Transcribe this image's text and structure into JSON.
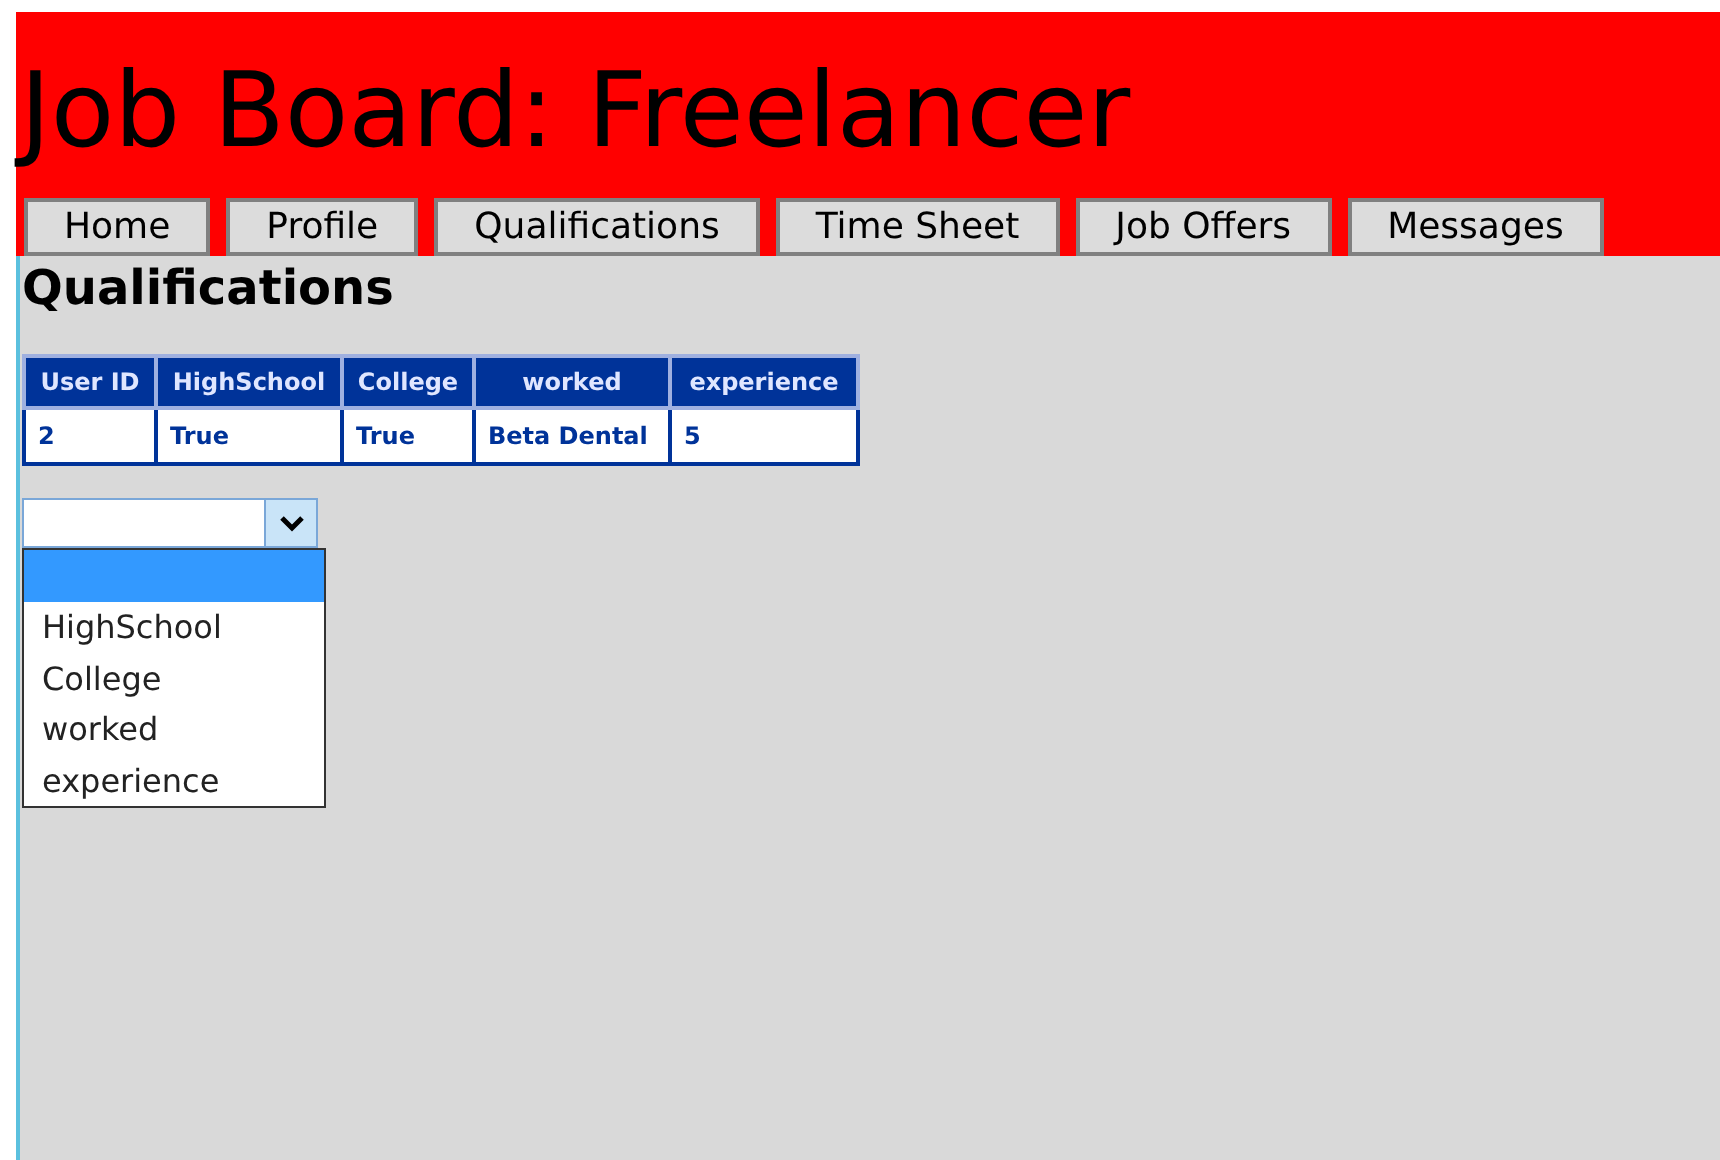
{
  "header": {
    "title": "Job Board: Freelancer"
  },
  "nav": [
    {
      "label": "Home"
    },
    {
      "label": "Profile"
    },
    {
      "label": "Qualifications"
    },
    {
      "label": "Time Sheet"
    },
    {
      "label": "Job Offers"
    },
    {
      "label": "Messages"
    }
  ],
  "heading": "Qualifications",
  "table": {
    "columns": [
      "User ID",
      "HighSchool",
      "College",
      "worked",
      "experience"
    ],
    "rows": [
      [
        "2",
        "True",
        "True",
        "Beta Dental",
        "5"
      ]
    ]
  },
  "dropdown": {
    "expanded": true,
    "blank_option": {
      "selected": true
    },
    "options": [
      {
        "label": "HighSchool",
        "selected": false
      },
      {
        "label": "College",
        "selected": false
      },
      {
        "label": "worked",
        "selected": false
      },
      {
        "label": "experience",
        "selected": false
      }
    ]
  }
}
